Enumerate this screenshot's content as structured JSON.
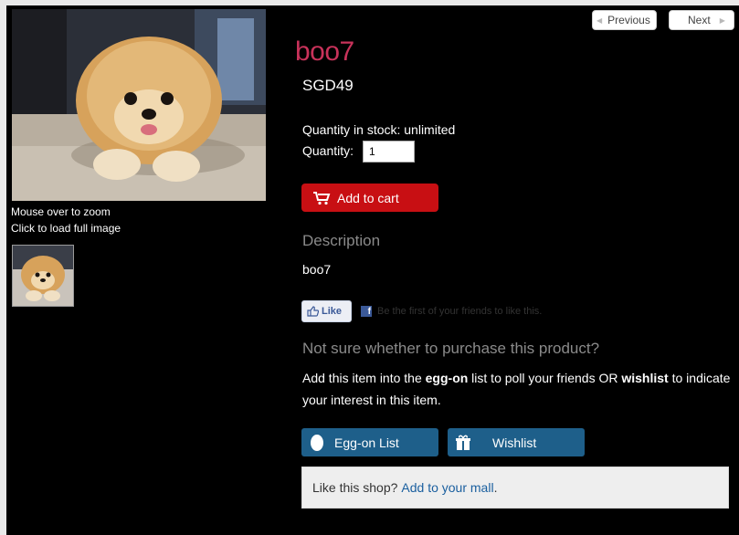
{
  "nav": {
    "previous_label": "Previous",
    "next_label": "Next"
  },
  "product": {
    "title": "boo7",
    "price": "SGD49",
    "stock_text": "Quantity in stock: unlimited",
    "quantity_label": "Quantity:",
    "quantity_value": "1"
  },
  "actions": {
    "add_to_cart_label": "Add to cart"
  },
  "gallery": {
    "zoom_hint": "Mouse over to zoom",
    "load_hint": "Click to load full image"
  },
  "description": {
    "heading": "Description",
    "text": "boo7"
  },
  "social": {
    "like_label": "Like",
    "fb_text": "Be the first of your friends to like this."
  },
  "purchase": {
    "heading": "Not sure whether to purchase this product?",
    "text_1": "Add this item into the ",
    "egg_on_bold": "egg-on",
    "text_2": " list to poll your friends OR ",
    "wishlist_bold": "wishlist",
    "text_3": " to indicate your interest in this item.",
    "egg_on_button": "Egg-on List",
    "wishlist_button": "Wishlist"
  },
  "mall": {
    "prompt": "Like this shop?",
    "link": "Add to your mall",
    "suffix": "."
  },
  "colors": {
    "background": "#000000",
    "title": "#c8325a",
    "cart_button": "#c80f13",
    "blue_button": "#1e5f8a",
    "link": "#1a5f9f"
  },
  "icons": [
    "cart-icon",
    "thumbs-up-icon",
    "facebook-icon",
    "egg-icon",
    "gift-icon",
    "chevron-left-icon",
    "chevron-right-icon"
  ]
}
